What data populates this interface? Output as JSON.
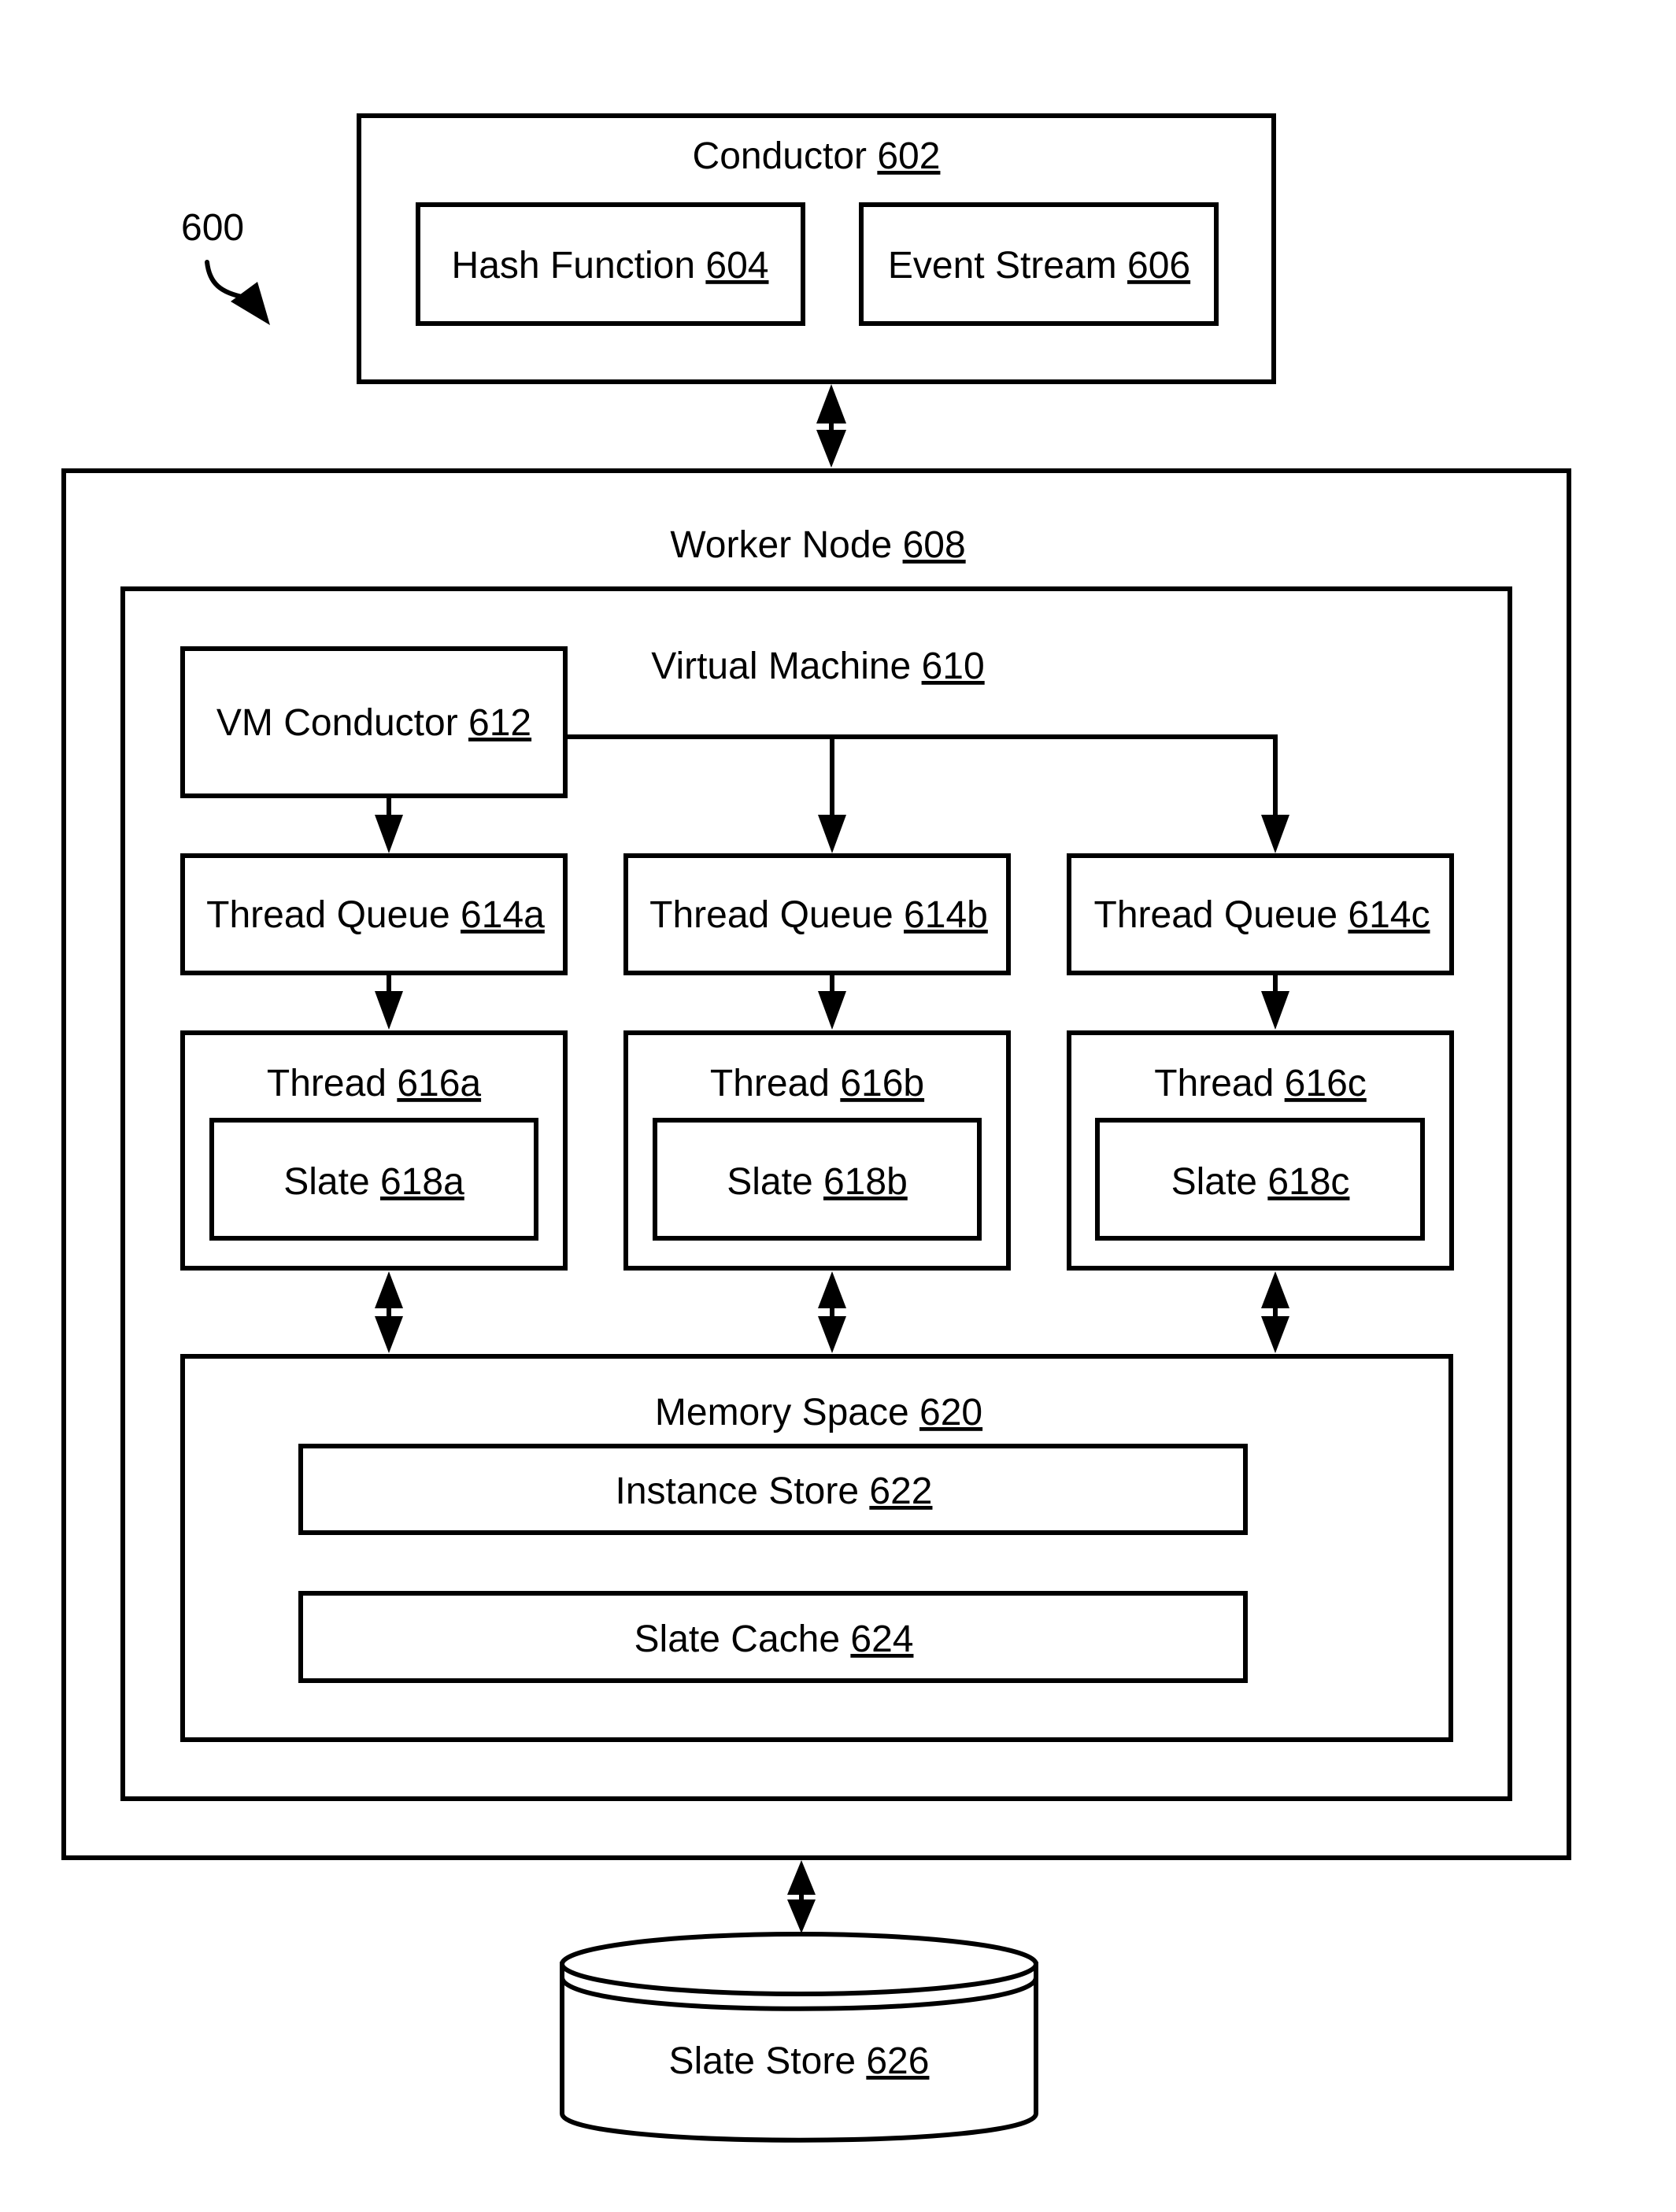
{
  "figure": {
    "reference_label": "600",
    "colors": {
      "stroke": "#000000",
      "background": "#ffffff"
    }
  },
  "conductor": {
    "name": "Conductor",
    "ref": "602",
    "hash_function": {
      "name": "Hash Function",
      "ref": "604"
    },
    "event_stream": {
      "name": "Event Stream",
      "ref": "606"
    }
  },
  "worker_node": {
    "name": "Worker Node",
    "ref": "608",
    "virtual_machine": {
      "name": "Virtual Machine",
      "ref": "610",
      "vm_conductor": {
        "name": "VM Conductor",
        "ref": "612"
      },
      "thread_queues": [
        {
          "name": "Thread Queue",
          "ref": "614a"
        },
        {
          "name": "Thread Queue",
          "ref": "614b"
        },
        {
          "name": "Thread Queue",
          "ref": "614c"
        }
      ],
      "threads": [
        {
          "name": "Thread",
          "ref": "616a",
          "slate": {
            "name": "Slate",
            "ref": "618a"
          }
        },
        {
          "name": "Thread",
          "ref": "616b",
          "slate": {
            "name": "Slate",
            "ref": "618b"
          }
        },
        {
          "name": "Thread",
          "ref": "616c",
          "slate": {
            "name": "Slate",
            "ref": "618c"
          }
        }
      ],
      "memory_space": {
        "name": "Memory Space",
        "ref": "620",
        "instance_store": {
          "name": "Instance Store",
          "ref": "622"
        },
        "slate_cache": {
          "name": "Slate Cache",
          "ref": "624"
        }
      }
    }
  },
  "slate_store": {
    "name": "Slate Store",
    "ref": "626"
  },
  "connections": [
    {
      "from": "Conductor 602",
      "to": "Worker Node 608",
      "type": "bidirectional"
    },
    {
      "from": "VM Conductor 612",
      "to": "Thread Queue 614a",
      "type": "directed"
    },
    {
      "from": "VM Conductor 612",
      "to": "Thread Queue 614b",
      "type": "directed"
    },
    {
      "from": "VM Conductor 612",
      "to": "Thread Queue 614c",
      "type": "directed"
    },
    {
      "from": "Thread Queue 614a",
      "to": "Thread 616a",
      "type": "directed"
    },
    {
      "from": "Thread Queue 614b",
      "to": "Thread 616b",
      "type": "directed"
    },
    {
      "from": "Thread Queue 614c",
      "to": "Thread 616c",
      "type": "directed"
    },
    {
      "from": "Thread 616a",
      "to": "Memory Space 620",
      "type": "bidirectional"
    },
    {
      "from": "Thread 616b",
      "to": "Memory Space 620",
      "type": "bidirectional"
    },
    {
      "from": "Thread 616c",
      "to": "Memory Space 620",
      "type": "bidirectional"
    },
    {
      "from": "Worker Node 608",
      "to": "Slate Store 626",
      "type": "bidirectional"
    }
  ]
}
